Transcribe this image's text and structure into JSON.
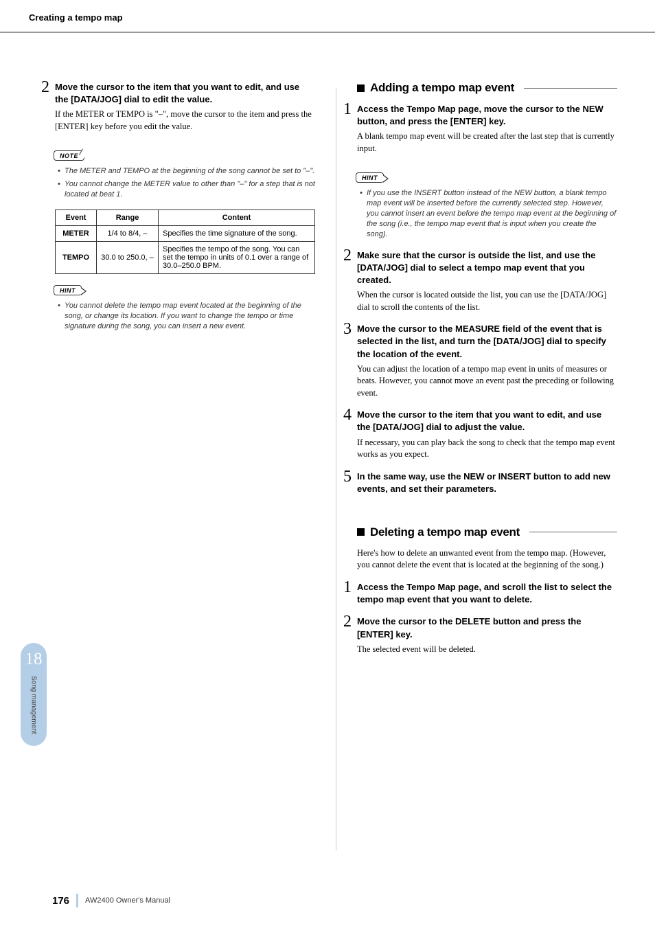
{
  "header": {
    "title": "Creating a tempo map"
  },
  "left": {
    "step2": {
      "num": "2",
      "head": "Move the cursor to the item that you want to edit, and use the [DATA/JOG] dial to edit the value.",
      "body": "If the METER or TEMPO is \"–\", move the cursor to the item and press the [ENTER] key before you edit the value."
    },
    "note_label": "NOTE",
    "notes": [
      "The METER and TEMPO at the beginning of the song cannot be set to \"–\".",
      "You cannot change the METER value to other than \"–\" for a step that is not located at beat 1."
    ],
    "table": {
      "headers": [
        "Event",
        "Range",
        "Content"
      ],
      "rows": [
        {
          "event": "METER",
          "range": "1/4 to 8/4, –",
          "content": "Specifies the time signature of the song."
        },
        {
          "event": "TEMPO",
          "range": "30.0 to 250.0, –",
          "content": "Specifies the tempo of the song. You can set the tempo in units of 0.1 over a range of 30.0–250.0 BPM."
        }
      ]
    },
    "hint_label": "HINT",
    "hints": [
      "You cannot delete the tempo map event located at the beginning of the song, or change its location. If you want to change the tempo or time signature during the song, you can insert a new event."
    ]
  },
  "right": {
    "section_add": "Adding a tempo map event",
    "add": {
      "s1": {
        "num": "1",
        "head": "Access the Tempo Map page, move the cursor to the NEW button, and press the [ENTER] key.",
        "body": "A blank tempo map event will be created after the last step that is currently input."
      },
      "hint_label": "HINT",
      "hints": [
        "If you use the INSERT button instead of the NEW button, a blank tempo map event will be inserted before the currently selected step. However, you cannot insert an event before the tempo map event at the beginning of the song (i.e., the tempo map event that is input when you create the song)."
      ],
      "s2": {
        "num": "2",
        "head": "Make sure that the cursor is outside the list, and use the [DATA/JOG] dial to select a tempo map event that you created.",
        "body": "When the cursor is located outside the list, you can use the [DATA/JOG] dial to scroll the contents of the list."
      },
      "s3": {
        "num": "3",
        "head": "Move the cursor to the MEASURE field of the event that is selected in the list, and turn the [DATA/JOG] dial to specify the location of the event.",
        "body": "You can adjust the location of a tempo map event in units of measures or beats. However, you cannot move an event past the preceding or following event."
      },
      "s4": {
        "num": "4",
        "head": "Move the cursor to the item that you want to edit, and use the [DATA/JOG] dial to adjust the value.",
        "body": "If necessary, you can play back the song to check that the tempo map event works as you expect."
      },
      "s5": {
        "num": "5",
        "head": "In the same way, use the NEW or INSERT button to add new events, and set their parameters."
      }
    },
    "section_del": "Deleting a tempo map event",
    "del_intro": "Here's how to delete an unwanted event from the tempo map. (However, you cannot delete the event that is located at the beginning of the song.)",
    "del": {
      "s1": {
        "num": "1",
        "head": "Access the Tempo Map page, and scroll the list to select the tempo map event that you want to delete."
      },
      "s2": {
        "num": "2",
        "head": "Move the cursor to the DELETE button and press the [ENTER] key.",
        "body": "The selected event will be deleted."
      }
    }
  },
  "tab": {
    "num": "18",
    "txt": "Song management"
  },
  "footer": {
    "page": "176",
    "txt": "AW2400  Owner's Manual"
  }
}
